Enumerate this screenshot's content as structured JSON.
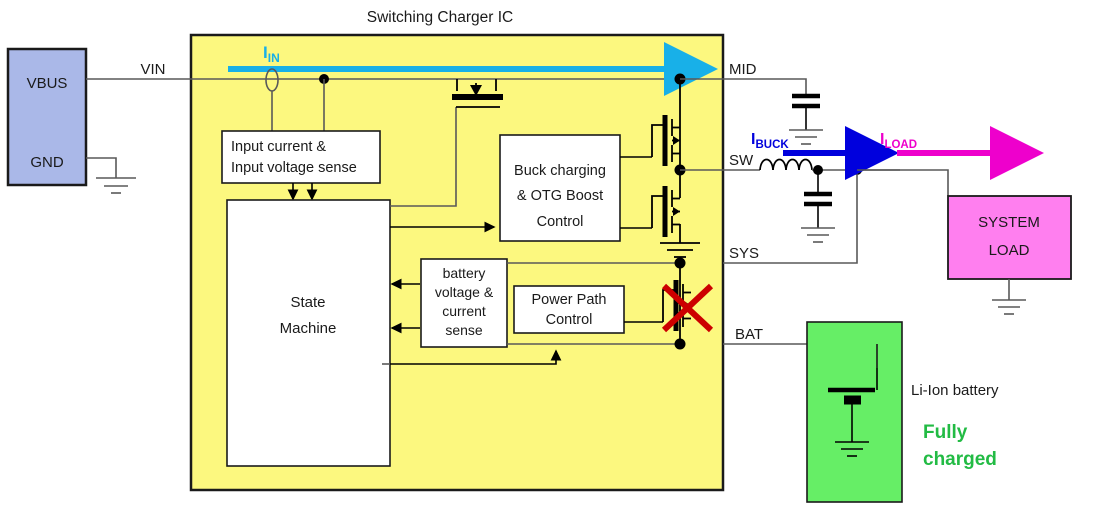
{
  "title": "Switching Charger IC",
  "blocks": {
    "source": {
      "top_label": "VBUS",
      "bottom_label": "GND",
      "color": "#aab8e8"
    },
    "input_sense": {
      "line1": "Input current &",
      "line2": "Input voltage sense"
    },
    "state_machine": {
      "line1": "State",
      "line2": "Machine"
    },
    "buck_control": {
      "line1": "Buck charging",
      "line2": "& OTG Boost",
      "line3": "Control"
    },
    "battery_sense": {
      "line1": "battery",
      "line2": "voltage &",
      "line3": "current",
      "line4": "sense"
    },
    "power_path": {
      "line1": "Power Path",
      "line2": "Control"
    },
    "system_load": {
      "line1": "SYSTEM",
      "line2": "LOAD",
      "color": "#ff7fef"
    },
    "battery_cell": {
      "color": "#66ee66"
    }
  },
  "pins": {
    "vin": "VIN",
    "mid": "MID",
    "sw": "SW",
    "sys": "SYS",
    "bat": "BAT"
  },
  "currents": {
    "iin": {
      "main": "I",
      "sub": "IN",
      "color": "#18b0e8"
    },
    "ibuck": {
      "main": "I",
      "sub": "BUCK",
      "color": "#0000dd"
    },
    "iload": {
      "main": "I",
      "sub": "LOAD",
      "color": "#ee00cc"
    }
  },
  "annotations": {
    "battery_caption": "Li-Ion battery",
    "status_line1": "Fully",
    "status_line2": "charged",
    "status_color": "#22bb44",
    "disabled_marker_color": "#cc0000"
  },
  "colors": {
    "ic_fill": "#fcf87f",
    "wire": "#595959",
    "symbol": "#000000"
  }
}
